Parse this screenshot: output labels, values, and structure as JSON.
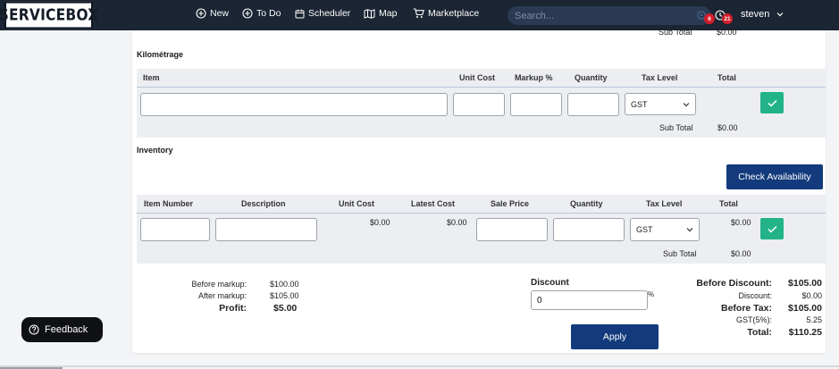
{
  "nav": {
    "logo": "SERVICEBOX",
    "items": [
      {
        "label": "New",
        "icon": "plus-circle-icon"
      },
      {
        "label": "To Do",
        "icon": "plus-circle-icon"
      },
      {
        "label": "Scheduler",
        "icon": "calendar-icon"
      },
      {
        "label": "Map",
        "icon": "map-icon"
      },
      {
        "label": "Marketplace",
        "icon": "cart-icon"
      }
    ],
    "search_placeholder": "Search...",
    "badge_left": "6",
    "badge_right": "21",
    "user": "steven"
  },
  "prev_section": {
    "sub_total_label": "Sub Total",
    "sub_total": "$0.00"
  },
  "kilometrage": {
    "title": "Kilométrage",
    "headers": {
      "item": "Item",
      "unit_cost": "Unit Cost",
      "markup": "Markup %",
      "quantity": "Quantity",
      "tax_level": "Tax Level",
      "total": "Total"
    },
    "row": {
      "item": "",
      "unit_cost": "",
      "markup": "",
      "quantity": "",
      "tax_level": "GST"
    },
    "sub_total_label": "Sub Total",
    "sub_total": "$0.00"
  },
  "inventory": {
    "title": "Inventory",
    "check_availability": "Check Availability",
    "headers": {
      "item_number": "Item Number",
      "description": "Description",
      "unit_cost": "Unit Cost",
      "latest_cost": "Latest Cost",
      "sale_price": "Sale Price",
      "quantity": "Quantity",
      "tax_level": "Tax Level",
      "total": "Total"
    },
    "row": {
      "item_number": "",
      "description": "",
      "unit_cost": "$0.00",
      "latest_cost": "$0.00",
      "sale_price": "",
      "quantity": "",
      "tax_level": "GST",
      "total": "$0.00"
    },
    "sub_total_label": "Sub Total",
    "sub_total": "$0.00"
  },
  "summary_left": {
    "before_markup_label": "Before markup:",
    "before_markup": "$100.00",
    "after_markup_label": "After markup:",
    "after_markup": "$105.00",
    "profit_label": "Profit:",
    "profit": "$5.00"
  },
  "discount": {
    "label": "Discount",
    "value": "0",
    "unit": "%",
    "apply": "Apply"
  },
  "summary_right": {
    "before_discount_label": "Before Discount:",
    "before_discount": "$105.00",
    "discount_label": "Discount:",
    "discount": "$0.00",
    "before_tax_label": "Before Tax:",
    "before_tax": "$105.00",
    "gst_label": "GST(5%):",
    "gst": "5.25",
    "total_label": "Total:",
    "total": "$110.25"
  },
  "feedback": "Feedback",
  "colors": {
    "navbar": "#1b2533",
    "primary_button": "#123a7c",
    "confirm_button": "#22b488",
    "badge": "#d31e2a"
  }
}
